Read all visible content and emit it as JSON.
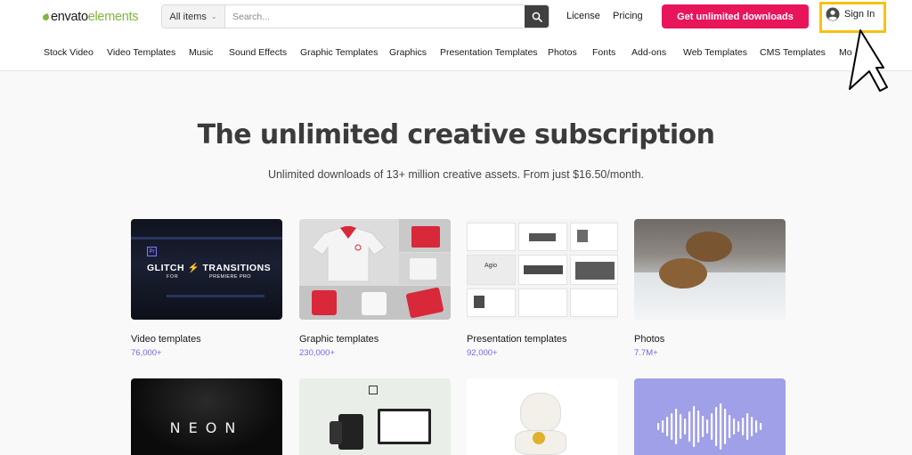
{
  "header": {
    "logo": {
      "brand": "envato",
      "product": "elements"
    },
    "search": {
      "category": "All items",
      "placeholder": "Search..."
    },
    "links": [
      "License",
      "Pricing"
    ],
    "cta_label": "Get unlimited downloads",
    "signin_label": "Sign In"
  },
  "categories": [
    "Stock Video",
    "Video Templates",
    "Music",
    "Sound Effects",
    "Graphic Templates",
    "Graphics",
    "Presentation Templates",
    "Photos",
    "Fonts",
    "Add-ons",
    "Web Templates",
    "CMS Templates",
    "Mo"
  ],
  "hero": {
    "title": "The unlimited creative subscription",
    "subtitle": "Unlimited downloads of 13+ million creative assets. From just $16.50/month."
  },
  "cards": [
    {
      "name": "Video templates",
      "count": "76,000+"
    },
    {
      "name": "Graphic templates",
      "count": "230,000+"
    },
    {
      "name": "Presentation templates",
      "count": "92,000+"
    },
    {
      "name": "Photos",
      "count": "7.7M+"
    }
  ],
  "thumb_text": {
    "video": {
      "badge": "Pr",
      "title_a": "GLITCH",
      "title_b": "TRANSITIONS",
      "for": "FOR",
      "product": "PREMIERE PRO"
    },
    "presentation": {
      "name": "Agio"
    },
    "neon": {
      "word": "NEON"
    }
  },
  "colors": {
    "accent": "#e8155b",
    "brand_green": "#82b541",
    "count_purple": "#7d63e8",
    "highlight": "#f5c211"
  }
}
